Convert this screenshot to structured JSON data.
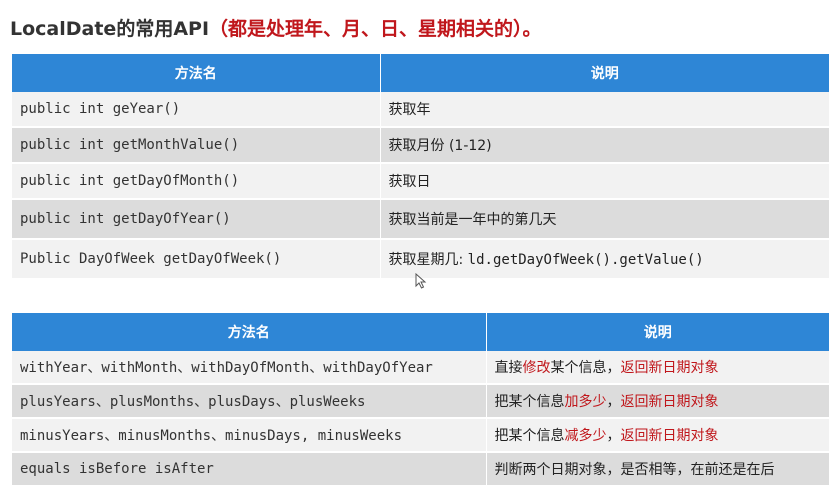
{
  "title": {
    "prefix": "LocalDate的常用API",
    "highlight": "（都是处理年、月、日、星期相关的）。"
  },
  "table1": {
    "headers": [
      "方法名",
      "说明"
    ],
    "rows": [
      {
        "method": "public int geYear()",
        "desc": "获取年"
      },
      {
        "method": "public int getMonthValue()",
        "desc": "获取月份 (1-12)"
      },
      {
        "method": "public int getDayOfMonth()",
        "desc": "获取日"
      },
      {
        "method": "public int getDayOfYear()",
        "desc": "获取当前是一年中的第几天"
      },
      {
        "method": "Public DayOfWeek getDayOfWeek()",
        "desc_prefix": "获取星期几: ",
        "desc_code": "ld.getDayOfWeek().getValue()"
      }
    ]
  },
  "table2": {
    "headers": [
      "方法名",
      "说明"
    ],
    "rows": [
      {
        "method": "withYear、withMonth、withDayOfMonth、withDayOfYear",
        "d1": "直接",
        "d2": "修改",
        "d3": "某个信息，",
        "d4": "返回新日期对象"
      },
      {
        "method": "plusYears、plusMonths、plusDays、plusWeeks",
        "d1": "把某个信息",
        "d2": "加多少",
        "d3": "，",
        "d4": "返回新日期对象"
      },
      {
        "method": "minusYears、minusMonths、minusDays, minusWeeks",
        "d1": "把某个信息",
        "d2": "减多少",
        "d3": "，",
        "d4": "返回新日期对象"
      },
      {
        "method": "equals isBefore isAfter",
        "desc": "判断两个日期对象，是否相等，在前还是在后"
      }
    ]
  },
  "colors": {
    "header_bg": "#2e86d6",
    "accent_red": "#c0171c",
    "row_light": "#f2f2f2",
    "row_dark": "#dcdcdc"
  }
}
